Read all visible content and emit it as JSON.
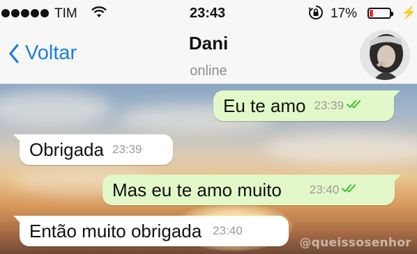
{
  "status_bar": {
    "carrier": "TIM",
    "time": "23:43",
    "battery_percent": "17%",
    "battery_level": 0.17,
    "signal_dots": 5
  },
  "nav": {
    "back_label": "Voltar",
    "contact_name": "Dani",
    "contact_status": "online"
  },
  "messages": [
    {
      "direction": "out",
      "text": "Eu te amo",
      "time": "23:39",
      "read": true
    },
    {
      "direction": "in",
      "text": "Obrigada",
      "time": "23:39"
    },
    {
      "direction": "out",
      "text": "Mas eu te amo muito",
      "time": "23:40",
      "read": true
    },
    {
      "direction": "in",
      "text": "Então muito obrigada",
      "time": "23:40"
    }
  ],
  "watermark": "@queissosenhor",
  "colors": {
    "accent": "#1f7dd6",
    "outgoing_bubble": "#e2f8c8",
    "incoming_bubble": "#ffffff",
    "read_ticks": "#4fbf4a",
    "battery_low": "#e3322c"
  },
  "icons": [
    "signal-dots-icon",
    "wifi-icon",
    "rotation-lock-icon",
    "battery-icon",
    "charging-bolt-icon",
    "chevron-left-icon",
    "double-check-icon"
  ]
}
